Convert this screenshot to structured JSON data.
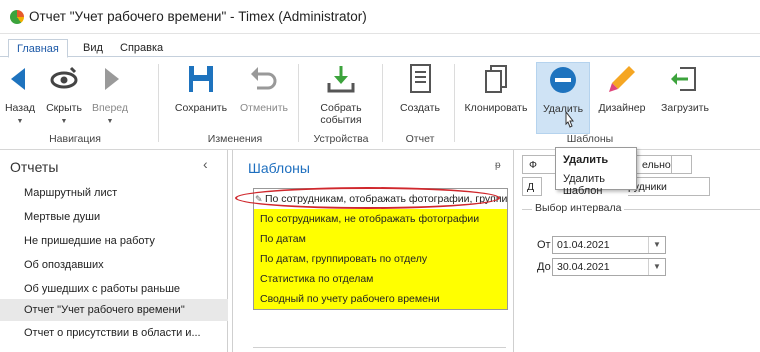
{
  "window": {
    "title": "Отчет \"Учет рабочего времени\" - Timex (Administrator)"
  },
  "tabs": [
    "Главная",
    "Вид",
    "Справка"
  ],
  "ribbon": {
    "buttons": {
      "back": "Назад",
      "hide": "Скрыть",
      "forward": "Вперед",
      "save": "Сохранить",
      "cancel": "Отменить",
      "collect_events": "Собрать события",
      "create": "Создать",
      "clone": "Клонировать",
      "delete": "Удалить",
      "designer": "Дизайнер",
      "load": "Загрузить"
    },
    "groups": {
      "navigation": "Навигация",
      "changes": "Изменения",
      "devices": "Устройства",
      "report": "Отчет",
      "templates": "Шаблоны"
    }
  },
  "tooltip": {
    "title": "Удалить",
    "text": "Удалить шаблон"
  },
  "reports_panel": {
    "title": "Отчеты",
    "items": [
      "Маршрутный лист",
      "Мертвые души",
      "Не пришедшие на работу",
      "Об опоздавших",
      "Об ушедших с работы раньше",
      "Отчет \"Учет рабочего времени\"",
      "Отчет о присутствии в области и..."
    ]
  },
  "templates_panel": {
    "title": "Шаблоны",
    "pin": "ᵽ",
    "items": [
      "По сотрудникам, отображать фотографии, группи",
      "По сотрудникам, не отображать фотографии",
      "По датам",
      "По датам, группировать по отделу",
      "Статистика по отделам",
      "Сводный по учету рабочего времени"
    ]
  },
  "right_panel": {
    "tab_top_left": "Ф",
    "tab_top_right": "ельно",
    "tab_sub_left": "Д",
    "tab_sub_right": "рудники",
    "group_title": "Выбор интервала",
    "from_label": "От",
    "from_value": "01.04.2021",
    "to_label": "До",
    "to_value": "30.04.2021"
  },
  "colors": {
    "highlight": "#ffff00",
    "accent": "#1e6fbf",
    "delete_icon": "#1e73be",
    "selection_ring": "#d0282d"
  }
}
